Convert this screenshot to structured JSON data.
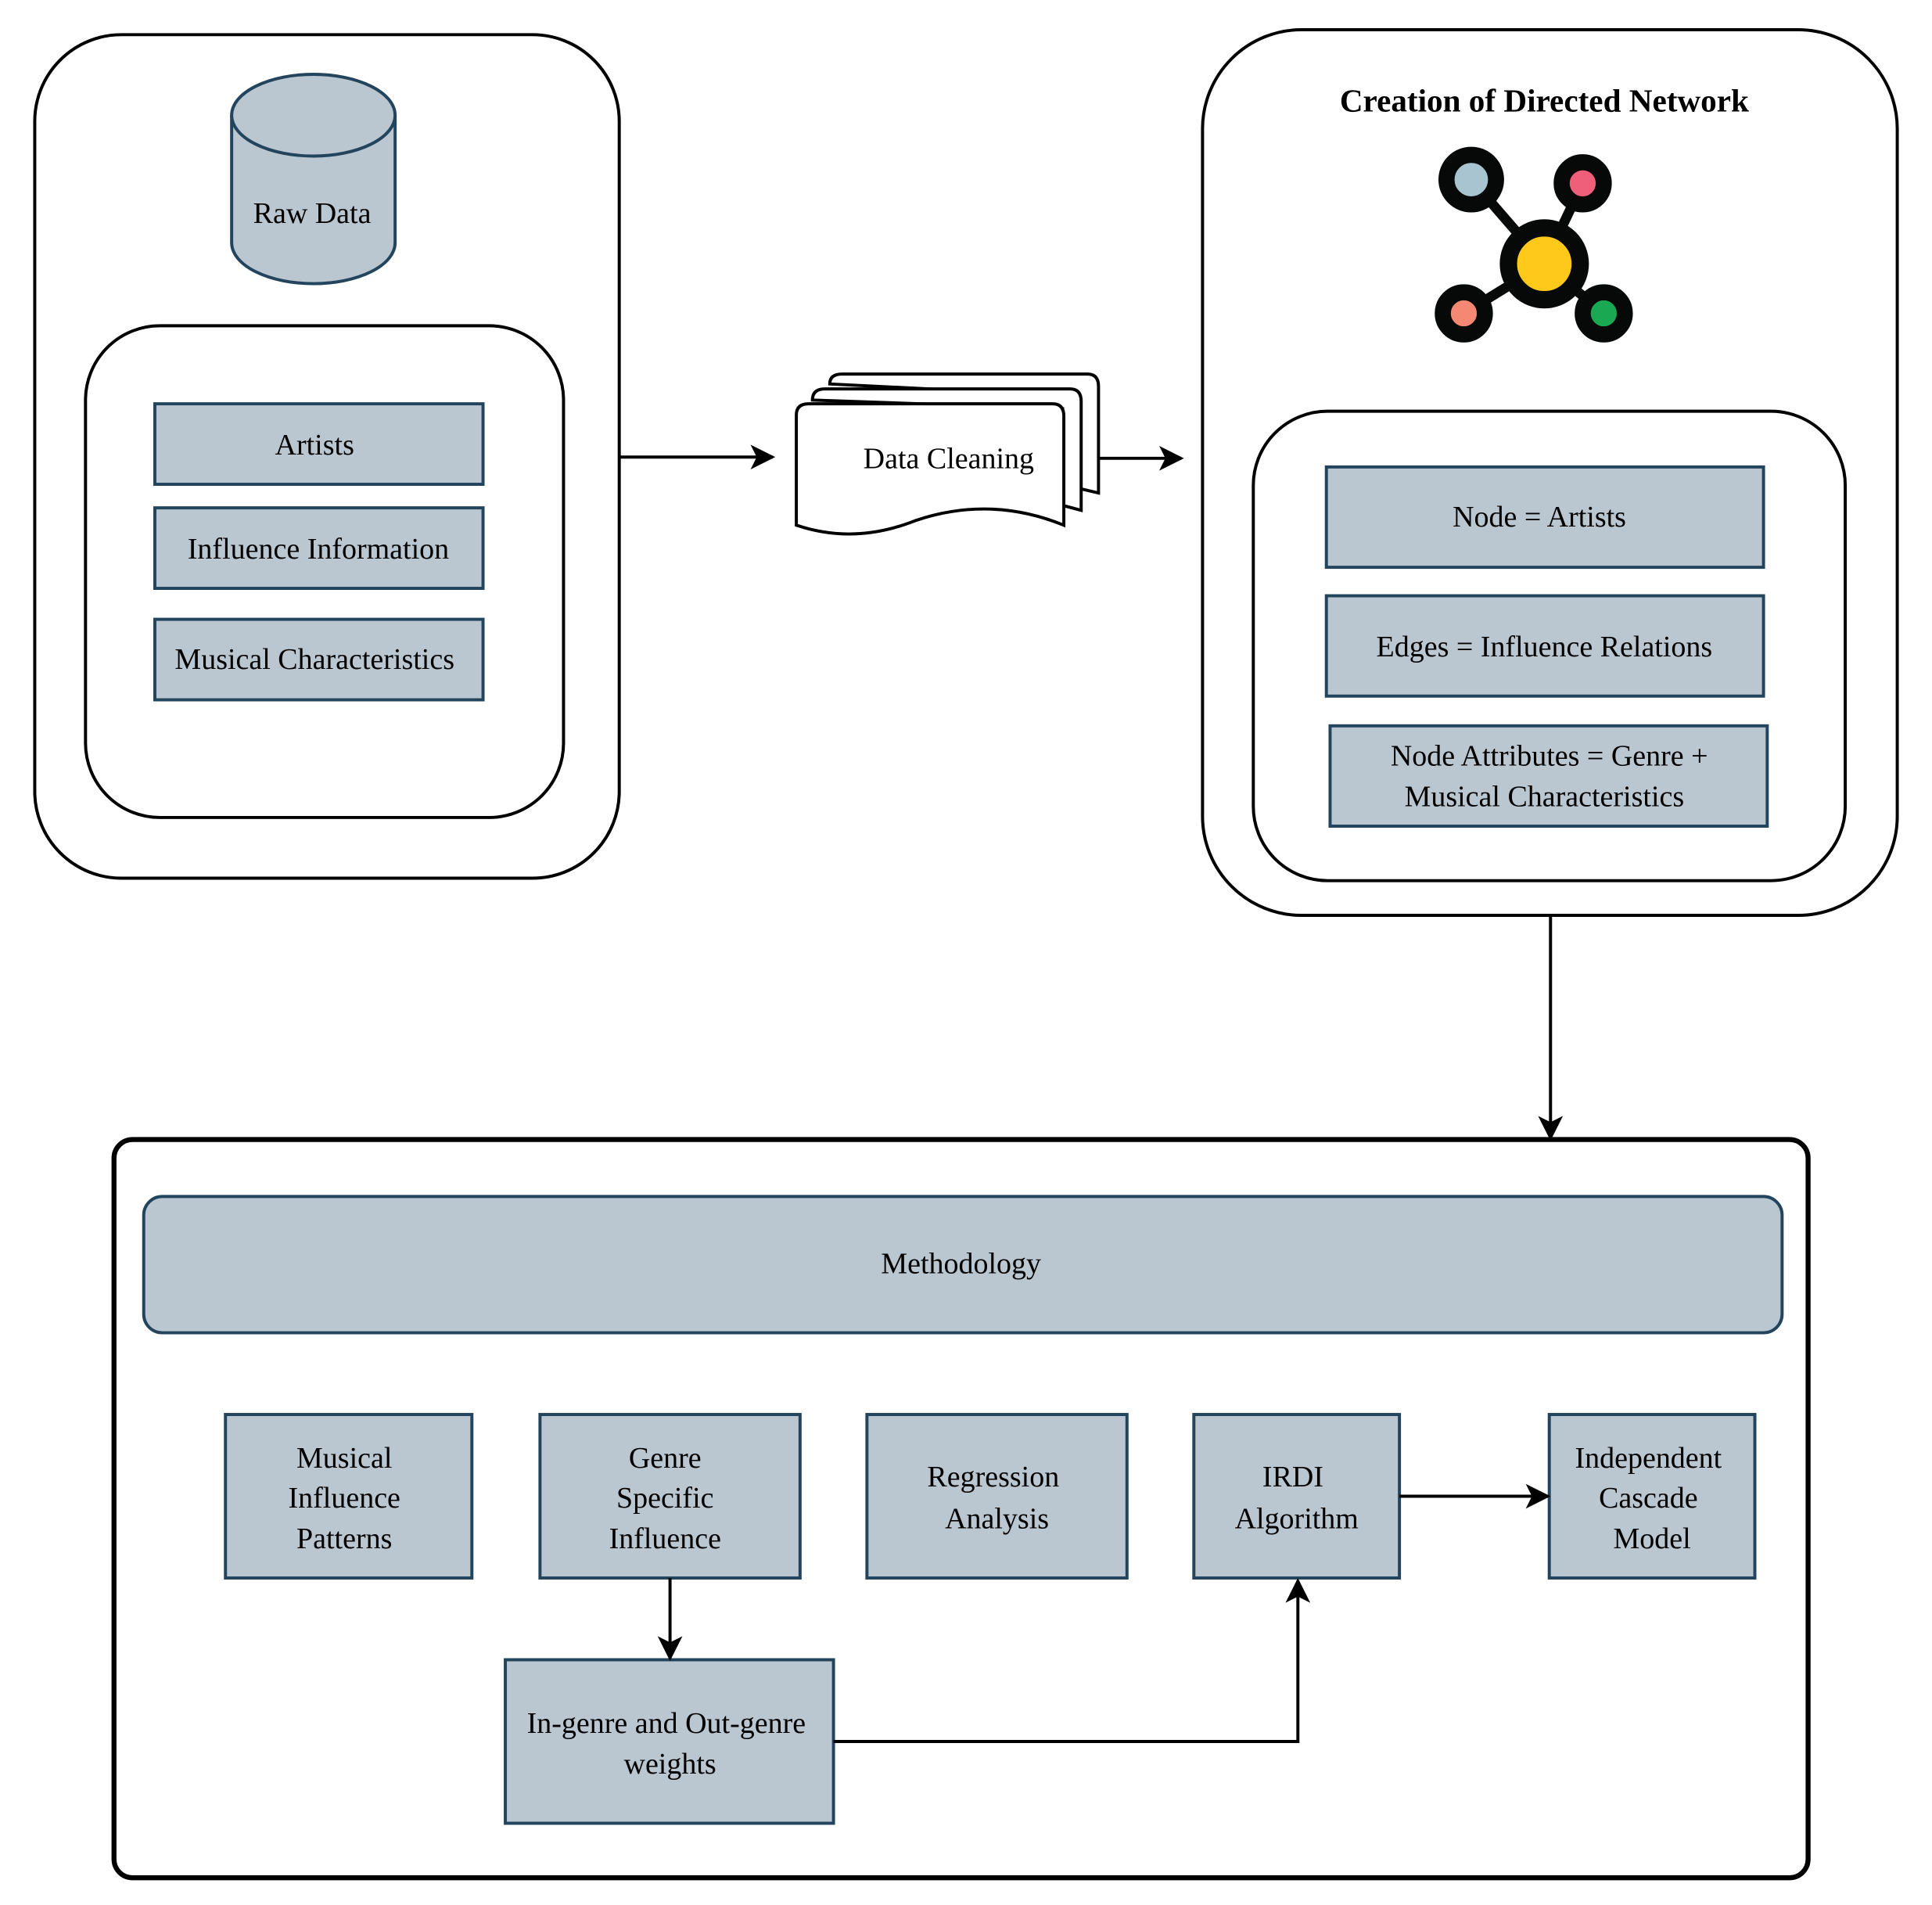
{
  "data_source": {
    "database_label": "Raw Data",
    "items": [
      "Artists",
      "Influence Information",
      "Musical Characteristics"
    ]
  },
  "cleaning": {
    "label": "Data Cleaning"
  },
  "network": {
    "title": "Creation of Directed Network",
    "icon": "network-graph-icon",
    "icon_colors": {
      "center": "#fec91b",
      "top_left": "#a8c4d0",
      "top_right": "#ef5f79",
      "bottom_left": "#f58872",
      "bottom_right": "#1aa853"
    },
    "items": [
      "Node = Artists",
      "Edges = Influence Relations",
      "Node Attributes = Genre +",
      "Musical Characteristics"
    ]
  },
  "methodology": {
    "header": "Methodology",
    "steps": [
      [
        "Musical",
        "Influence",
        "Patterns"
      ],
      [
        "Genre",
        "Specific",
        "Influence"
      ],
      [
        "Regression",
        "Analysis"
      ],
      [
        "IRDI",
        "Algorithm"
      ],
      [
        "Independent",
        "Cascade",
        "Model"
      ]
    ],
    "weights": [
      "In-genre and Out-genre",
      "weights"
    ]
  },
  "colors": {
    "box_fill": "#bac6d0",
    "box_stroke": "#23445d"
  }
}
